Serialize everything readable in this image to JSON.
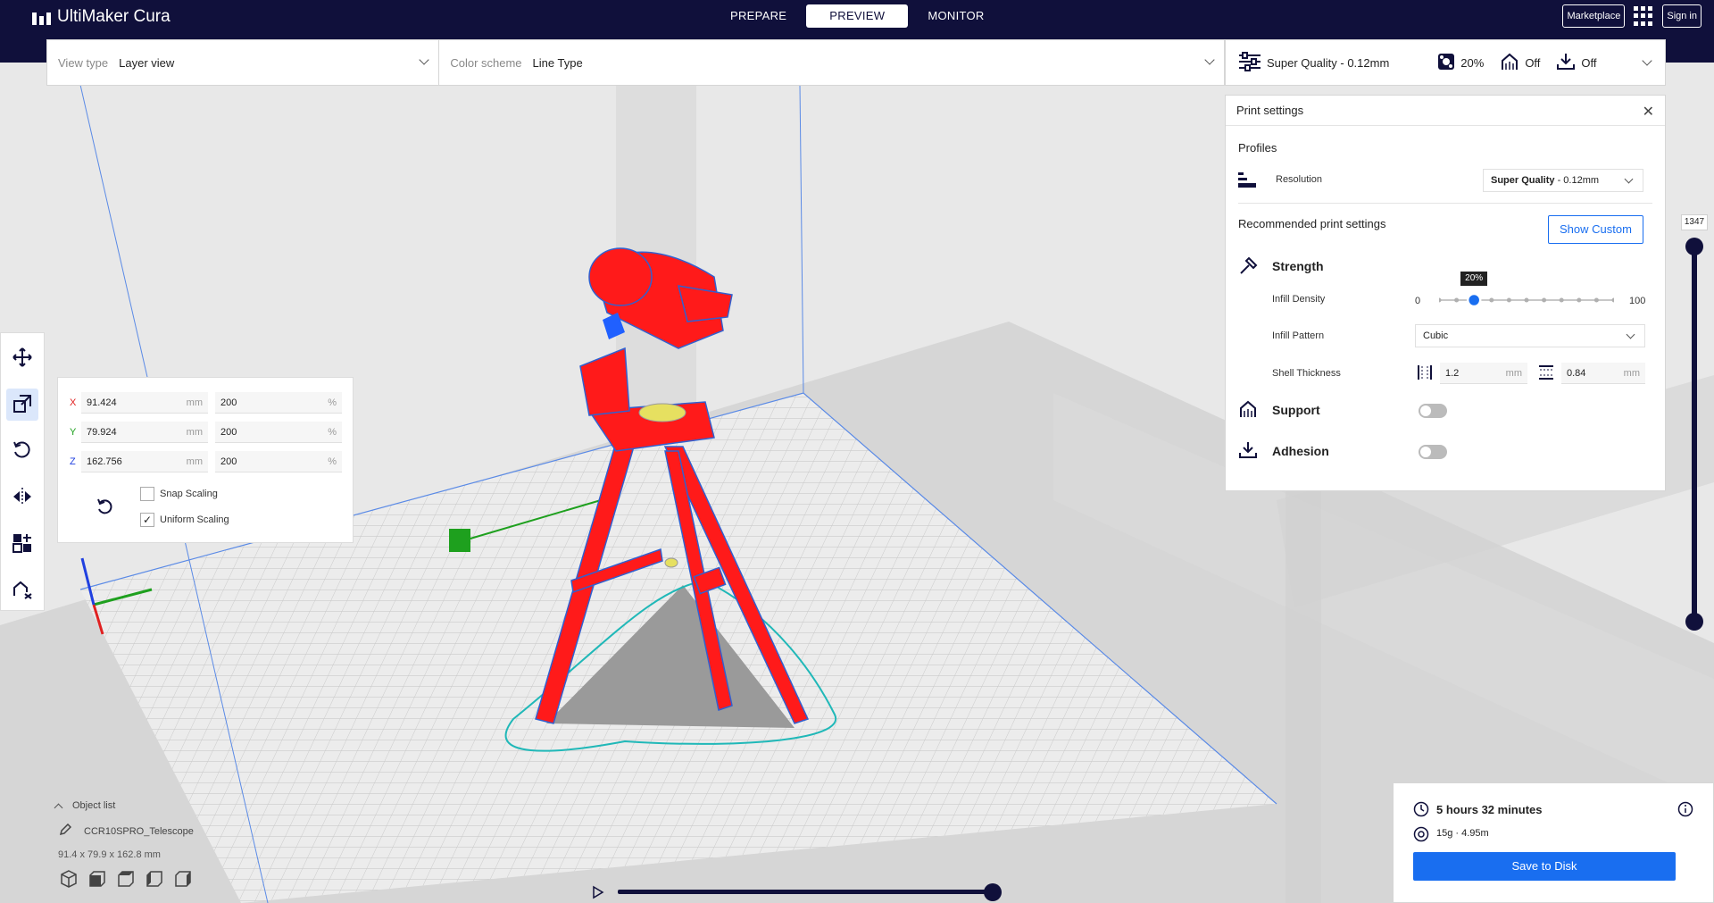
{
  "app": {
    "title": "UltiMaker Cura"
  },
  "nav": {
    "tabs": [
      {
        "label": "PREPARE",
        "active": false
      },
      {
        "label": "PREVIEW",
        "active": true
      },
      {
        "label": "MONITOR",
        "active": false
      }
    ],
    "marketplace_label": "Marketplace",
    "signin_label": "Sign in"
  },
  "viewbar": {
    "view_type_label": "View type",
    "view_type_value": "Layer view",
    "color_scheme_label": "Color scheme",
    "color_scheme_value": "Line Type"
  },
  "quality_bar": {
    "profile": "Super Quality - 0.12mm",
    "infill": "20%",
    "support": "Off",
    "adhesion": "Off"
  },
  "print_settings": {
    "title": "Print settings",
    "profiles_label": "Profiles",
    "resolution_label": "Resolution",
    "resolution_value_bold": "Super Quality",
    "resolution_value_rest": " - 0.12mm",
    "recommended_label": "Recommended print settings",
    "show_custom_label": "Show Custom",
    "strength_label": "Strength",
    "infill_density_label": "Infill Density",
    "infill_min": "0",
    "infill_max": "100",
    "infill_value": 20,
    "infill_tooltip": "20%",
    "infill_pattern_label": "Infill Pattern",
    "infill_pattern_value": "Cubic",
    "shell_thickness_label": "Shell Thickness",
    "wall_value": "1.2",
    "top_bottom_value": "0.84",
    "unit_mm": "mm",
    "support_label": "Support",
    "support_on": false,
    "adhesion_label": "Adhesion",
    "adhesion_on": false
  },
  "layer_slider": {
    "value": "1347"
  },
  "scale_panel": {
    "x_label": "X",
    "x_mm": "91.424",
    "x_pct": "200",
    "y_label": "Y",
    "y_mm": "79.924",
    "y_pct": "200",
    "z_label": "Z",
    "z_mm": "162.756",
    "z_pct": "200",
    "unit_mm": "mm",
    "unit_pct": "%",
    "snap_scaling_label": "Snap Scaling",
    "snap_scaling_checked": false,
    "uniform_scaling_label": "Uniform Scaling",
    "uniform_scaling_checked": true
  },
  "object_list": {
    "toggle_label": "Object list",
    "object_name": "CCR10SPRO_Telescope",
    "dimensions": "91.4 x 79.9 x 162.8 mm"
  },
  "print_info": {
    "time": "5 hours 32 minutes",
    "material": "15g · 4.95m",
    "save_label": "Save to Disk"
  },
  "colors": {
    "topbar": "#10103b",
    "accent": "#196ef0",
    "model": "#ff1a1a"
  }
}
